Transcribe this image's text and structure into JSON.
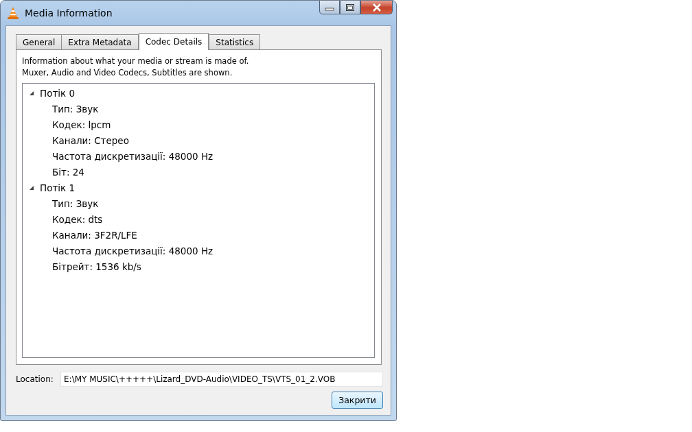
{
  "window": {
    "title": "Media Information"
  },
  "tabs": [
    {
      "label": "General",
      "selected": false
    },
    {
      "label": "Extra Metadata",
      "selected": false
    },
    {
      "label": "Codec Details",
      "selected": true
    },
    {
      "label": "Statistics",
      "selected": false
    }
  ],
  "description": [
    "Information about what your media or stream is made of.",
    "Muxer, Audio and Video Codecs, Subtitles are shown."
  ],
  "tree": [
    {
      "label": "Потік 0",
      "expanded": true,
      "children": [
        {
          "label": "Тип: Звук"
        },
        {
          "label": "Кодек: lpcm"
        },
        {
          "label": "Канали: Стерео"
        },
        {
          "label": "Частота дискретизації: 48000 Hz"
        },
        {
          "label": "Біт: 24"
        }
      ]
    },
    {
      "label": "Потік 1",
      "expanded": true,
      "children": [
        {
          "label": "Тип: Звук"
        },
        {
          "label": "Кодек: dts"
        },
        {
          "label": "Канали: 3F2R/LFE"
        },
        {
          "label": "Частота дискретизації: 48000 Hz"
        },
        {
          "label": "Бітрейт: 1536 kb/s"
        }
      ]
    }
  ],
  "location": {
    "label": "Location:",
    "value": "E:\\MY MUSIC\\+++++\\Lizard_DVD-Audio\\VIDEO_TS\\VTS_01_2.VOB"
  },
  "close_button": "Закрити"
}
